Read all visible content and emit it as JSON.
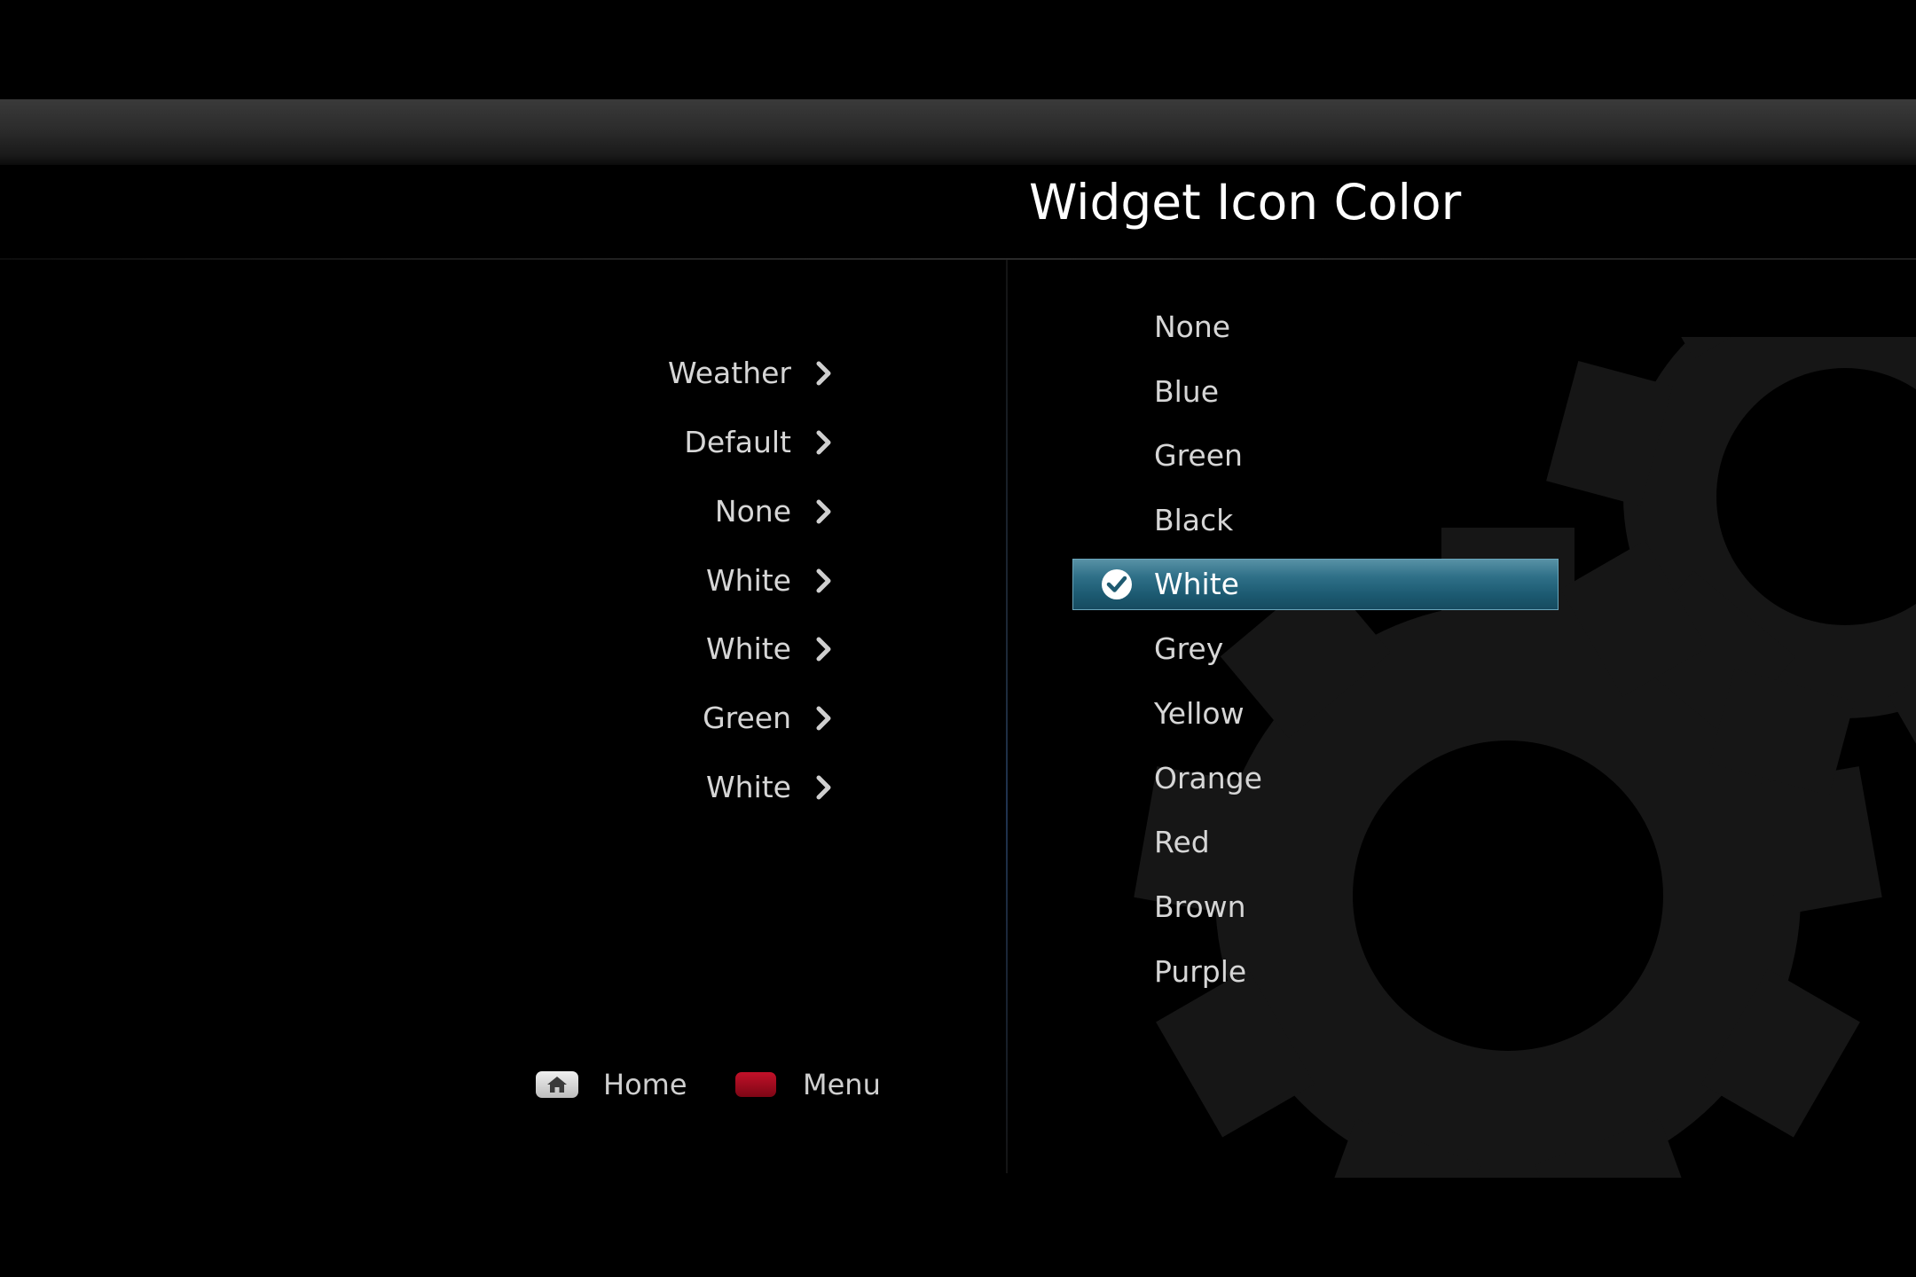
{
  "header": {
    "title": "Widget Icon Color"
  },
  "summary": {
    "items": [
      {
        "label": "Weather"
      },
      {
        "label": "Default"
      },
      {
        "label": "None"
      },
      {
        "label": "White"
      },
      {
        "label": "White"
      },
      {
        "label": "Green"
      },
      {
        "label": "White"
      }
    ]
  },
  "options": {
    "selected": "White",
    "items": [
      {
        "label": "None"
      },
      {
        "label": "Blue"
      },
      {
        "label": "Green"
      },
      {
        "label": "Black"
      },
      {
        "label": "White",
        "selected": true
      },
      {
        "label": "Grey"
      },
      {
        "label": "Yellow"
      },
      {
        "label": "Orange"
      },
      {
        "label": "Red"
      },
      {
        "label": "Brown"
      },
      {
        "label": "Purple"
      }
    ]
  },
  "footer": {
    "home_label": "Home",
    "home_icon": "home-icon",
    "menu_label": "Menu",
    "menu_key_color": "#b00d22"
  },
  "colors": {
    "accent": "#2a6f88",
    "background": "#000000",
    "text": "#d6d6d6"
  }
}
